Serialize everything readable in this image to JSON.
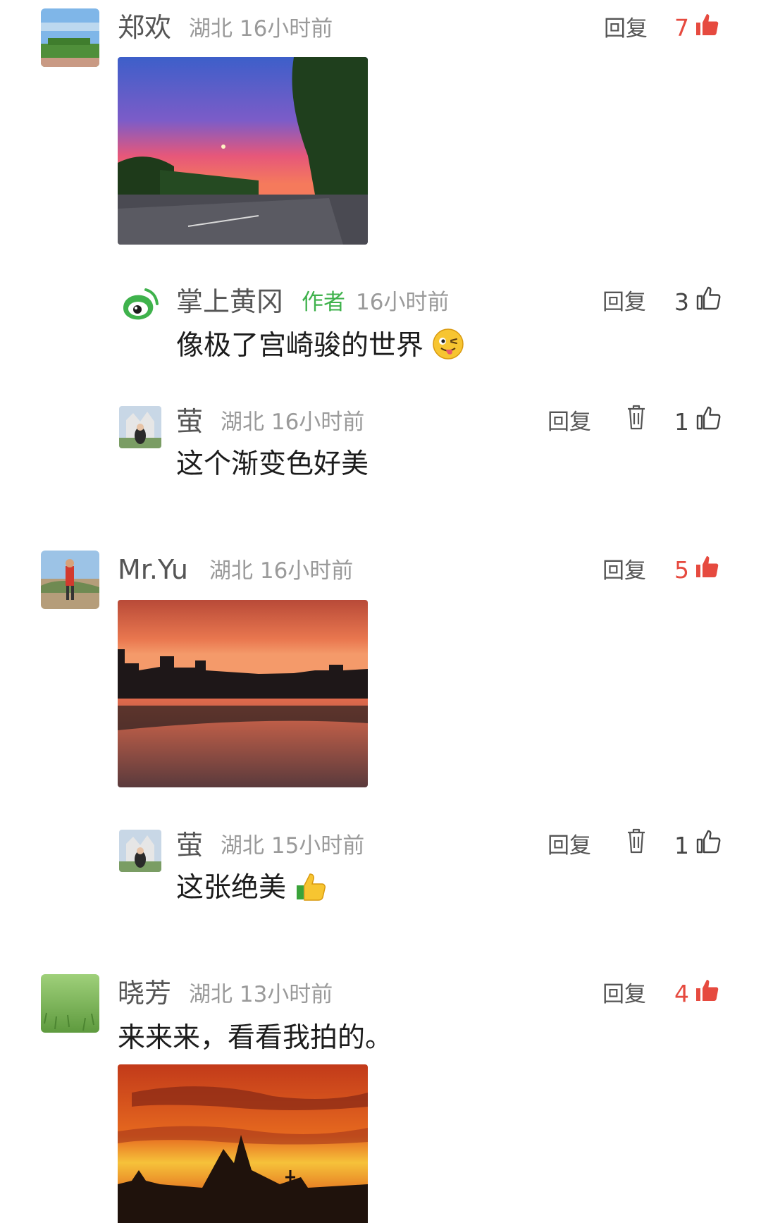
{
  "colors": {
    "like_active": "#e64a3f",
    "author_tag": "#3fb24c",
    "meta_text": "#9a9a9a"
  },
  "comments": [
    {
      "name": "郑欢",
      "meta": "湖北 16小时前",
      "reply": "回复",
      "likes": "7",
      "liked": true,
      "avatar_icon": "park-avatar",
      "image": "sunset-road-photo"
    },
    {
      "name": "掌上黄冈",
      "tag": "作者",
      "meta": "16小时前",
      "reply": "回复",
      "likes": "3",
      "liked": false,
      "avatar_icon": "weibo-logo",
      "text": "像极了宫崎骏的世界",
      "emoji": "winking-tongue-emoji"
    },
    {
      "name": "萤",
      "meta": "湖北 16小时前",
      "reply": "回复",
      "likes": "1",
      "liked": false,
      "avatar_icon": "person-avatar",
      "text": "这个渐变色好美",
      "delete_icon": "trash-icon"
    },
    {
      "name": "Mr.Yu",
      "meta": "湖北 16小时前",
      "reply": "回复",
      "likes": "5",
      "liked": true,
      "avatar_icon": "runner-avatar",
      "image": "sunset-lake-photo"
    },
    {
      "name": "萤",
      "meta": "湖北 15小时前",
      "reply": "回复",
      "likes": "1",
      "liked": false,
      "avatar_icon": "person-avatar",
      "text": "这张绝美",
      "emoji": "thumbs-up-emoji",
      "delete_icon": "trash-icon"
    },
    {
      "name": "晓芳",
      "meta": "湖北 13小时前",
      "reply": "回复",
      "likes": "4",
      "liked": true,
      "avatar_icon": "grass-avatar",
      "text": "来来来，看看我拍的。",
      "image": "orange-sky-photo"
    }
  ]
}
